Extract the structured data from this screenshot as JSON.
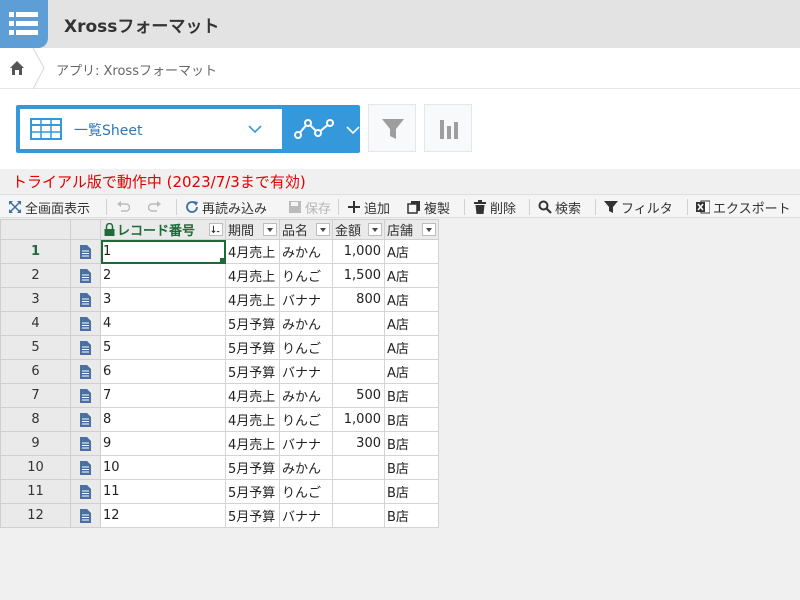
{
  "app": {
    "title": "Xrossフォーマット",
    "breadcrumb": "アプリ: Xrossフォーマット"
  },
  "view": {
    "name": "一覧Sheet"
  },
  "trial_notice": "トライアル版で動作中 (2023/7/3まで有効)",
  "toolbar": {
    "fullscreen": "全画面表示",
    "reload": "再読み込み",
    "save": "保存",
    "add": "追加",
    "duplicate": "複製",
    "delete": "削除",
    "search": "検索",
    "filter": "フィルタ",
    "export": "エクスポート"
  },
  "grid": {
    "columns": [
      "レコード番号",
      "期間",
      "品名",
      "金額",
      "店舗"
    ],
    "rows": [
      {
        "num": "1",
        "id": "1",
        "period": "4月売上",
        "item": "みかん",
        "amount": "1,000",
        "store": "A店"
      },
      {
        "num": "2",
        "id": "2",
        "period": "4月売上",
        "item": "りんご",
        "amount": "1,500",
        "store": "A店"
      },
      {
        "num": "3",
        "id": "3",
        "period": "4月売上",
        "item": "バナナ",
        "amount": "800",
        "store": "A店"
      },
      {
        "num": "4",
        "id": "4",
        "period": "5月予算",
        "item": "みかん",
        "amount": "",
        "store": "A店"
      },
      {
        "num": "5",
        "id": "5",
        "period": "5月予算",
        "item": "りんご",
        "amount": "",
        "store": "A店"
      },
      {
        "num": "6",
        "id": "6",
        "period": "5月予算",
        "item": "バナナ",
        "amount": "",
        "store": "A店"
      },
      {
        "num": "7",
        "id": "7",
        "period": "4月売上",
        "item": "みかん",
        "amount": "500",
        "store": "B店"
      },
      {
        "num": "8",
        "id": "8",
        "period": "4月売上",
        "item": "りんご",
        "amount": "1,000",
        "store": "B店"
      },
      {
        "num": "9",
        "id": "9",
        "period": "4月売上",
        "item": "バナナ",
        "amount": "300",
        "store": "B店"
      },
      {
        "num": "10",
        "id": "10",
        "period": "5月予算",
        "item": "みかん",
        "amount": "",
        "store": "B店"
      },
      {
        "num": "11",
        "id": "11",
        "period": "5月予算",
        "item": "りんご",
        "amount": "",
        "store": "B店"
      },
      {
        "num": "12",
        "id": "12",
        "period": "5月予算",
        "item": "バナナ",
        "amount": "",
        "store": "B店"
      }
    ]
  },
  "colors": {
    "accent_blue": "#3498db",
    "trial_red": "#e00000",
    "key_green": "#1e6b3a"
  }
}
